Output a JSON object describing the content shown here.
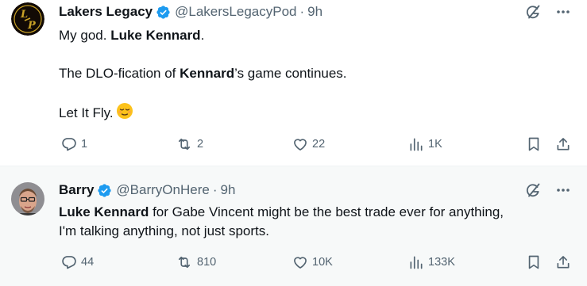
{
  "tweets": [
    {
      "author": {
        "name": "Lakers Legacy",
        "handle": "@LakersLegacyPod",
        "separator": "·",
        "time": "9h"
      },
      "avatar_text": [
        "L",
        "P"
      ],
      "text": {
        "p1_pre": "My god. ",
        "p1_bold": "Luke Kennard",
        "p1_post": ".",
        "p2_pre": "The DLO-fication of ",
        "p2_bold": "Kennard",
        "p2_post": "’s game continues.",
        "p3": "Let It Fly."
      },
      "emoji": "relieved-face",
      "stats": {
        "replies": "1",
        "retweets": "2",
        "likes": "22",
        "views": "1K"
      }
    },
    {
      "author": {
        "name": "Barry",
        "handle": "@BarryOnHere",
        "separator": "·",
        "time": "9h"
      },
      "text": {
        "line1_bold": "Luke Kennard",
        "line1_post": " for Gabe Vincent might be the best trade ever for anything,",
        "line2": "I'm talking anything, not just sports."
      },
      "stats": {
        "replies": "44",
        "retweets": "810",
        "likes": "10K",
        "views": "133K"
      }
    }
  ],
  "colors": {
    "verified": "#1d9bf0",
    "muted": "#536471",
    "text": "#0f1419",
    "hover_bg": "#f7f9f9"
  }
}
